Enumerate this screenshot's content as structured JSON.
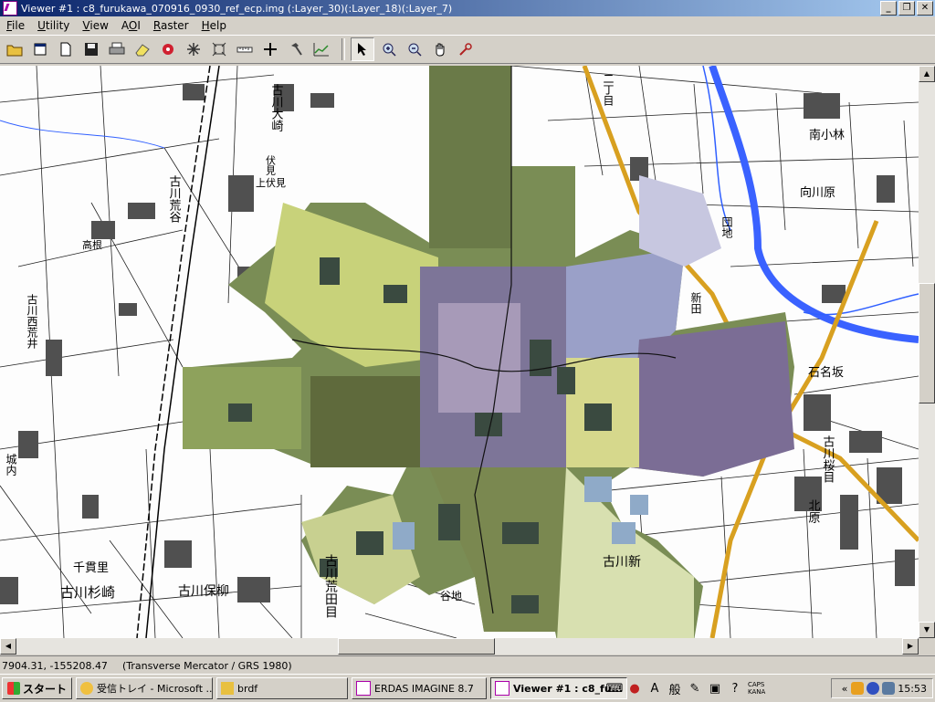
{
  "window": {
    "title": "Viewer #1 : c8_furukawa_070916_0930_ref_ecp.img (:Layer_30)(:Layer_18)(:Layer_7)",
    "minimize": "_",
    "maximize": "❐",
    "close": "✕"
  },
  "menu": {
    "file": {
      "mnemonic": "F",
      "rest": "ile"
    },
    "utility": {
      "mnemonic": "U",
      "rest": "tility"
    },
    "view": {
      "mnemonic": "V",
      "rest": "iew"
    },
    "aoi": {
      "pre": "A",
      "mnemonic": "O",
      "rest": "I"
    },
    "raster": {
      "mnemonic": "R",
      "rest": "aster"
    },
    "help": {
      "mnemonic": "H",
      "rest": "elp"
    }
  },
  "toolbar": {
    "icons": [
      "open-folder-icon",
      "new-viewer-icon",
      "document-icon",
      "save-icon",
      "print-icon",
      "eraser-icon",
      "aoi-info-icon",
      "starburst-icon",
      "fit-extent-icon",
      "measure-icon",
      "crosshair-icon",
      "hammer-icon",
      "profile-icon",
      "select-arrow-icon",
      "zoom-in-icon",
      "zoom-out-icon",
      "pan-hand-icon",
      "inquire-icon"
    ],
    "selected": "select-arrow-icon"
  },
  "map": {
    "labels": [
      {
        "text": "古川大崎",
        "color": "#000"
      },
      {
        "text": "古川荒谷",
        "color": "#000"
      },
      {
        "text": "伏見",
        "color": "#000"
      },
      {
        "text": "上伏見",
        "color": "#000"
      },
      {
        "text": "高根",
        "color": "#000"
      },
      {
        "text": "古川西荒井",
        "color": "#000"
      },
      {
        "text": "南小林",
        "color": "#000"
      },
      {
        "text": "向川原",
        "color": "#000"
      },
      {
        "text": "団地",
        "color": "#000"
      },
      {
        "text": "新田",
        "color": "#000"
      },
      {
        "text": "石名坂",
        "color": "#000"
      },
      {
        "text": "古川桜目",
        "color": "#000"
      },
      {
        "text": "北原",
        "color": "#000"
      },
      {
        "text": "古川新",
        "color": "#000"
      },
      {
        "text": "千貫里",
        "color": "#000"
      },
      {
        "text": "古川杉崎",
        "color": "#000"
      },
      {
        "text": "古川保柳",
        "color": "#000"
      },
      {
        "text": "古川荒田目",
        "color": "#000"
      },
      {
        "text": "谷地",
        "color": "#000"
      },
      {
        "text": "城内",
        "color": "#000"
      },
      {
        "text": "二丁目",
        "color": "#000"
      }
    ],
    "road_color": "#d8a020",
    "river_color": "#2f5fff"
  },
  "status": {
    "coords": "7904.31, -155208.47",
    "projection": "(Transverse Mercator / GRS 1980)"
  },
  "taskbar": {
    "start": "スタート",
    "tasks": [
      {
        "label": "受信トレイ - Microsoft ...",
        "icon": "outlook-icon",
        "active": false
      },
      {
        "label": "brdf",
        "icon": "folder-icon",
        "active": false
      },
      {
        "label": "ERDAS IMAGINE 8.7",
        "icon": "erdas-icon",
        "active": false
      },
      {
        "label": "Viewer #1 : c8_fu...",
        "icon": "viewer-icon",
        "active": true
      }
    ],
    "ime": {
      "mode": "A",
      "kana": "般",
      "caps": "CAPS",
      "kana_small": "KANA"
    },
    "tray_arrow": "«",
    "clock": "15:53"
  }
}
